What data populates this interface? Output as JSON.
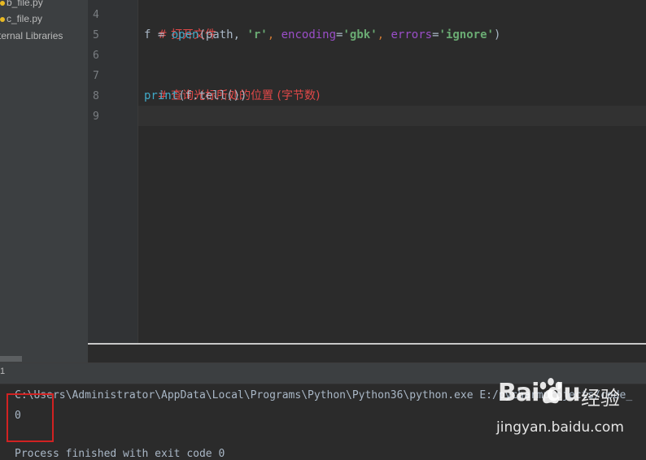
{
  "project_tree": {
    "items": [
      {
        "label": "b_file.py",
        "type": "python-file"
      },
      {
        "label": "c_file.py",
        "type": "python-file"
      },
      {
        "label": "ternal Libraries",
        "type": "library"
      }
    ]
  },
  "editor": {
    "line_numbers": [
      "4",
      "5",
      "6",
      "7",
      "8",
      "9"
    ],
    "lines": {
      "l4": "# 打开文件",
      "l5": {
        "var": "f ",
        "eq": "= ",
        "func": "open",
        "args_start": "(path, ",
        "mode": "'r'",
        "comma1": ", ",
        "kw1": "encoding",
        "eq1": "=",
        "enc": "'gbk'",
        "comma2": ", ",
        "kw2": "errors",
        "eq2": "=",
        "err": "'ignore'",
        "close": ")"
      },
      "l7": "# 查询光标所处的位置 (字节数)",
      "l8": {
        "func": "print",
        "rest": "(f.tell())"
      }
    }
  },
  "run_panel": {
    "tab_number": "1",
    "command": "C:\\Users\\Administrator\\AppData\\Local\\Programs\\Python\\Python36\\python.exe E:/pycharmprojects/code_",
    "output": "0",
    "finish": "Process finished with exit code 0"
  },
  "watermark": {
    "brand": "Bai du",
    "jingyan": "经验",
    "url": "jingyan.baidu.com"
  },
  "colors": {
    "comment": "#e04848",
    "builtin": "#41a8c6",
    "string": "#6aab73",
    "keyword_arg": "#9a4ec8",
    "highlight_box": "#d12222"
  }
}
